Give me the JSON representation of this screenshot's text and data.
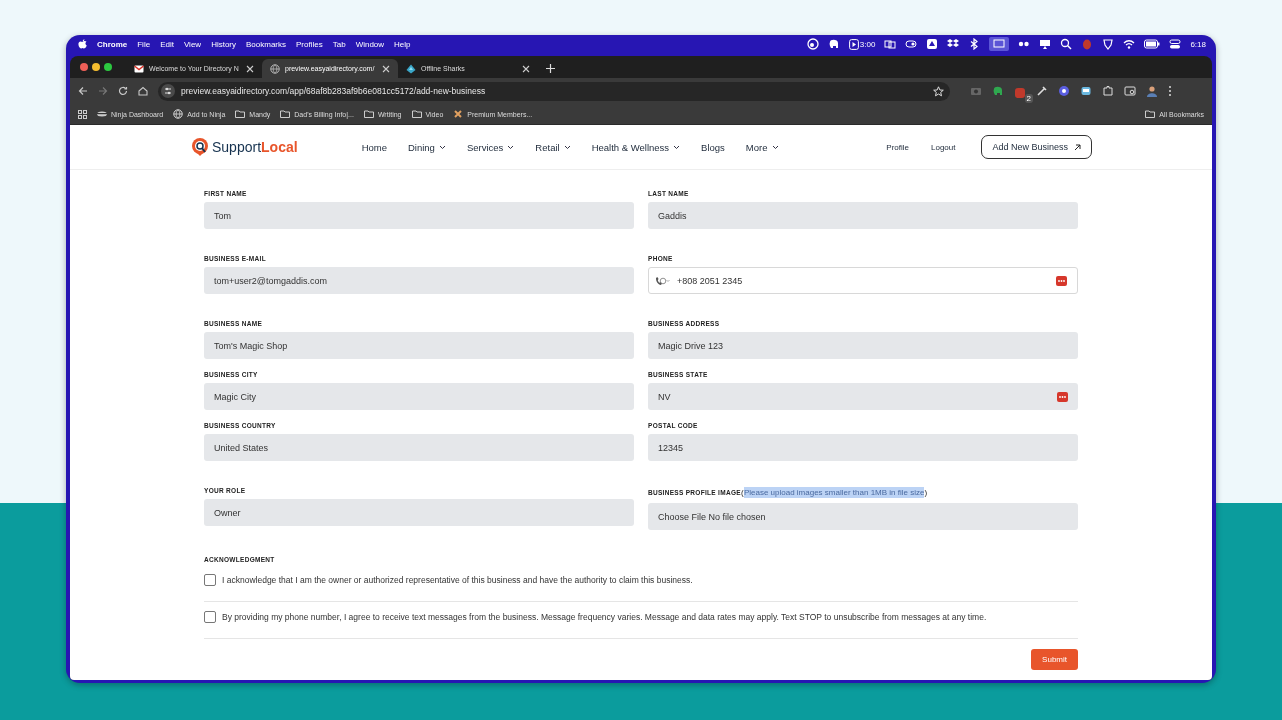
{
  "menu_bar": {
    "app": "Chrome",
    "items": [
      "File",
      "Edit",
      "View",
      "History",
      "Bookmarks",
      "Profiles",
      "Tab",
      "Window",
      "Help"
    ],
    "timer": "3:00",
    "clock": "6:18"
  },
  "browser": {
    "tabs": [
      {
        "title": "Welcome to Your Directory N",
        "selected": false
      },
      {
        "title": "preview.easyaidirectory.com/",
        "selected": true
      },
      {
        "title": "Offline Sharks",
        "selected": false
      }
    ],
    "address": "preview.easyaidirectory.com/app/68af8b283af9b6e081cc5172/add-new-business",
    "extension_badge": "2",
    "bookmarks": [
      {
        "label": "Ninja Dashboard"
      },
      {
        "label": "Add to Ninja"
      },
      {
        "label": "Mandy"
      },
      {
        "label": "Dad's Billing Info|..."
      },
      {
        "label": "Wrtiting"
      },
      {
        "label": "Video"
      },
      {
        "label": "Premium Members..."
      }
    ],
    "all_bookmarks": "All Bookmarks"
  },
  "site": {
    "brand": {
      "first": "Support",
      "second": "Local"
    },
    "nav": [
      {
        "label": "Home",
        "dropdown": false
      },
      {
        "label": "Dining",
        "dropdown": true
      },
      {
        "label": "Services",
        "dropdown": true
      },
      {
        "label": "Retail",
        "dropdown": true
      },
      {
        "label": "Health & Wellness",
        "dropdown": true
      },
      {
        "label": "Blogs",
        "dropdown": false
      },
      {
        "label": "More",
        "dropdown": true
      }
    ],
    "links": [
      "Profile",
      "Logout"
    ],
    "cta": "Add New Business"
  },
  "form": {
    "sections": [
      [
        [
          {
            "label": "FIRST NAME",
            "value": "Tom",
            "kind": "text"
          },
          {
            "label": "LAST NAME",
            "value": "Gaddis",
            "kind": "text"
          }
        ]
      ],
      [
        [
          {
            "label": "BUSINESS E-MAIL",
            "value": "tom+user2@tomgaddis.com",
            "kind": "text"
          },
          {
            "label": "PHONE",
            "value": "+808 2051 2345",
            "kind": "phone",
            "autofill": true
          }
        ]
      ],
      [
        [
          {
            "label": "BUSINESS NAME",
            "value": "Tom's Magic Shop",
            "kind": "text"
          },
          {
            "label": "BUSINESS ADDRESS",
            "value": "Magic Drive 123",
            "kind": "text"
          }
        ],
        [
          {
            "label": "BUSINESS CITY",
            "value": "Magic City",
            "kind": "text"
          },
          {
            "label": "BUSINESS STATE",
            "value": "NV",
            "kind": "text",
            "autofill": true
          }
        ],
        [
          {
            "label": "BUSINESS COUNTRY",
            "value": "United States",
            "kind": "text"
          },
          {
            "label": "POSTAL CODE",
            "value": "12345",
            "kind": "text"
          }
        ]
      ],
      [
        [
          {
            "label": "YOUR ROLE",
            "value": "Owner",
            "kind": "text"
          },
          {
            "label": "BUSINESS PROFILE IMAGE",
            "hint": {
              "open": "(",
              "text": "Please upload images smaller than 1MB in file size",
              "close": ")",
              "selected": true
            },
            "kind": "file",
            "button": "Choose File",
            "value": "No file chosen"
          }
        ]
      ]
    ],
    "acknowledgment": {
      "heading": "ACKNOWLEDGMENT",
      "checks": [
        {
          "text": "I acknowledge that I am the owner or authorized representative of this business and have the authority to claim this business.",
          "checked": false
        },
        {
          "text": "By providing my phone number, I agree to receive text messages from the business. Message frequency varies. Message and data rates may apply. Text STOP to unsubscribe from messages at any time.",
          "checked": false
        }
      ]
    },
    "submit": "Submit"
  }
}
